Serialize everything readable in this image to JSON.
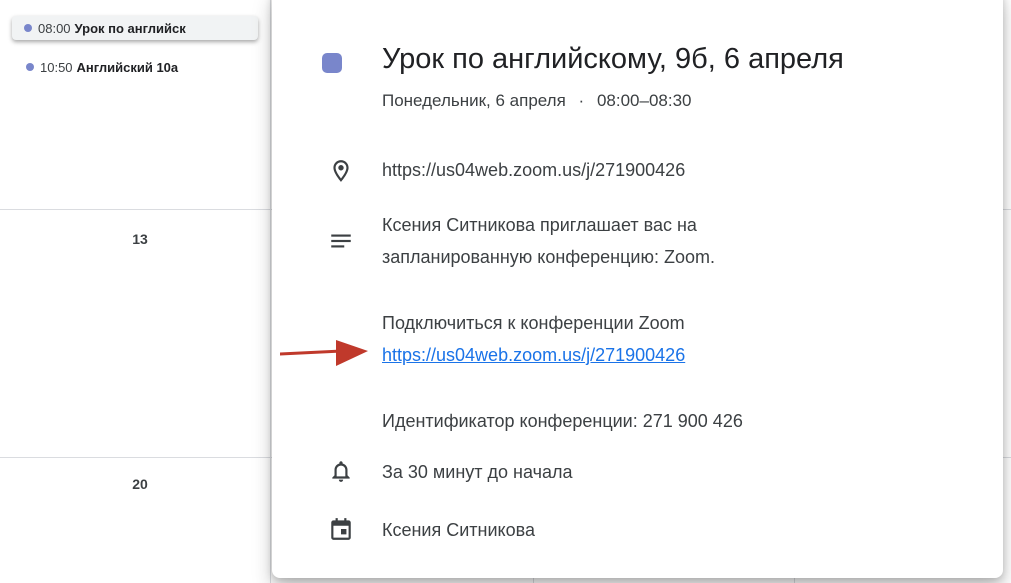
{
  "calendar": {
    "events": [
      {
        "time": "08:00",
        "title": "Урок по английск",
        "color": "#7986cb",
        "selected": true
      },
      {
        "time": "10:50",
        "title": "Английский 10а",
        "color": "#7986cb",
        "selected": false
      }
    ],
    "day_numbers": [
      "13",
      "20"
    ]
  },
  "popup": {
    "color": "#7986cb",
    "title": "Урок по английскому, 9б, 6 апреля",
    "date": "Понедельник, 6 апреля",
    "separator": "·",
    "time_range": "08:00–08:30",
    "location": "https://us04web.zoom.us/j/271900426",
    "description": {
      "line1": "Ксения Ситникова приглашает вас на",
      "line2": "запланированную конференцию: Zoom.",
      "join_label": "Подключиться к конференции Zoom",
      "join_link": "https://us04web.zoom.us/j/271900426",
      "meeting_id": "Идентификатор конференции: 271 900 426"
    },
    "reminder": "За 30 минут до начала",
    "calendar_owner": "Ксения Ситникова"
  },
  "icons": {
    "location": "location-pin-icon",
    "description": "notes-lines-icon",
    "reminder": "bell-icon",
    "calendar": "calendar-icon"
  },
  "annotation": {
    "arrow_color": "#c0392b"
  }
}
